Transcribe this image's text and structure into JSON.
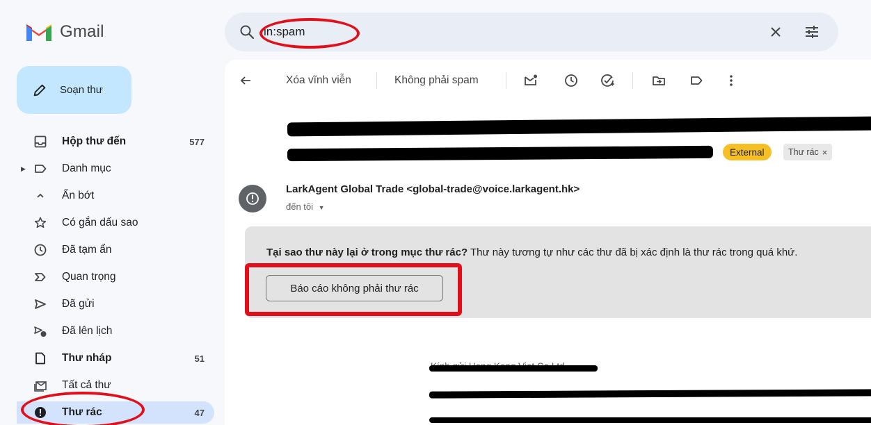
{
  "app": {
    "name": "Gmail"
  },
  "search": {
    "query": "in:spam"
  },
  "compose": {
    "label": "Soạn thư"
  },
  "nav": [
    {
      "label": "Hộp thư đến",
      "count": "577"
    },
    {
      "label": "Danh mục",
      "count": ""
    },
    {
      "label": "Ẩn bớt",
      "count": ""
    },
    {
      "label": "Có gắn dấu sao",
      "count": ""
    },
    {
      "label": "Đã tạm ẩn",
      "count": ""
    },
    {
      "label": "Quan trọng",
      "count": ""
    },
    {
      "label": "Đã gửi",
      "count": ""
    },
    {
      "label": "Đã lên lịch",
      "count": ""
    },
    {
      "label": "Thư nháp",
      "count": "51"
    },
    {
      "label": "Tất cả thư",
      "count": ""
    },
    {
      "label": "Thư rác",
      "count": "47"
    }
  ],
  "toolbar": {
    "delete_forever": "Xóa vĩnh viễn",
    "not_spam": "Không phải spam"
  },
  "email": {
    "labels": {
      "external": "External",
      "spam": "Thư rác"
    },
    "sender": "LarkAgent Global Trade <global-trade@voice.larkagent.hk>",
    "recipient": "đến tôi",
    "warning_bold": "Tại sao thư này lại ở trong mục thư rác?",
    "warning_rest": " Thư này tương tự như các thư đã bị xác định là thư rác trong quá khứ.",
    "report_button": "Báo cáo không phải thư rác",
    "greeting": "Kính gửi Hong Kong Viet Co.Ltd,"
  },
  "colors": {
    "annotation": "#e0101a",
    "compose": "#c2e7ff",
    "active_nav": "#d3e3fd",
    "external_badge": "#f6bf26"
  }
}
